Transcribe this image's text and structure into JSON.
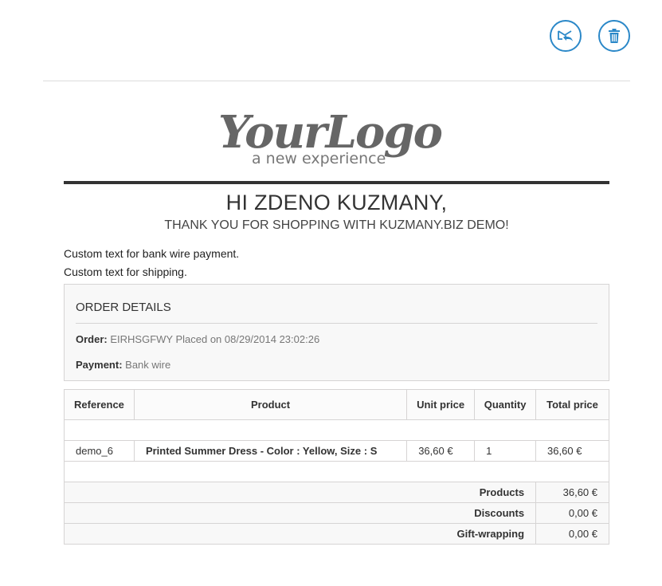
{
  "actions": {
    "reply_icon": "reply-all-icon",
    "delete_icon": "trash-icon",
    "accent": "#2b88c8"
  },
  "logo": {
    "text": "YourLogo",
    "tagline": "a new experience"
  },
  "greeting": "HI ZDENO KUZMANY,",
  "thanks": "THANK YOU FOR SHOPPING WITH KUZMANY.BIZ DEMO!",
  "custom_texts": [
    "Custom text for bank wire payment.",
    "Custom text for shipping."
  ],
  "order_details": {
    "title": "ORDER DETAILS",
    "order_label": "Order:",
    "order_value": "EIRHSGFWY Placed on 08/29/2014 23:02:26",
    "payment_label": "Payment:",
    "payment_value": "Bank wire"
  },
  "table": {
    "headers": [
      "Reference",
      "Product",
      "Unit price",
      "Quantity",
      "Total price"
    ],
    "rows": [
      {
        "reference": "demo_6",
        "product": "Printed Summer Dress - Color : Yellow, Size : S",
        "unit_price": "36,60 €",
        "quantity": "1",
        "total_price": "36,60 €"
      }
    ],
    "summary": [
      {
        "label": "Products",
        "value": "36,60 €"
      },
      {
        "label": "Discounts",
        "value": "0,00 €"
      },
      {
        "label": "Gift-wrapping",
        "value": "0,00 €"
      }
    ]
  }
}
